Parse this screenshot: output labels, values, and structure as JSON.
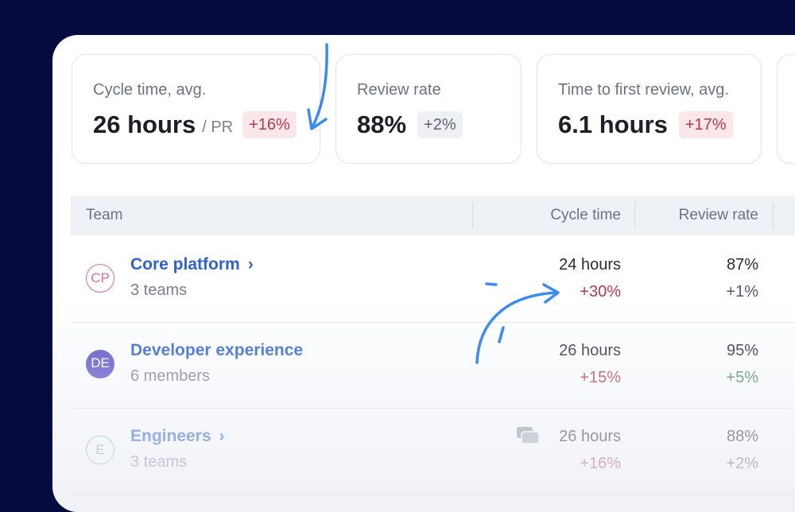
{
  "metrics": [
    {
      "label": "Cycle time, avg.",
      "value": "26 hours",
      "unit": "/ PR",
      "delta": "+16%",
      "delta_tone": "red"
    },
    {
      "label": "Review rate",
      "value": "88%",
      "unit": "",
      "delta": "+2%",
      "delta_tone": "gray"
    },
    {
      "label": "Time to first review, avg.",
      "value": "6.1 hours",
      "unit": "",
      "delta": "+17%",
      "delta_tone": "red"
    }
  ],
  "table": {
    "headers": {
      "team": "Team",
      "cycle_time": "Cycle time",
      "review_rate": "Review rate"
    },
    "rows": [
      {
        "initials": "CP",
        "name": "Core platform",
        "sub": "3 teams",
        "cycle_time": "24 hours",
        "cycle_delta": "+30%",
        "review_rate": "87%",
        "review_delta": "+1%",
        "avatar_color": "#d36aa8",
        "avatar_style": "outline"
      },
      {
        "initials": "DE",
        "name": "Developer experience",
        "sub": "6 members",
        "cycle_time": "26 hours",
        "cycle_delta": "+15%",
        "review_rate": "95%",
        "review_delta": "+5%",
        "avatar_color": "#5b4fc4",
        "avatar_style": "filled"
      },
      {
        "initials": "E",
        "name": "Engineers",
        "sub": "3 teams",
        "cycle_time": "26 hours",
        "cycle_delta": "+16%",
        "review_rate": "88%",
        "review_delta": "+2%",
        "avatar_color": "#5fb0c4",
        "avatar_style": "outline"
      }
    ]
  },
  "colors": {
    "accent": "#2f63c7",
    "annotation": "#3d8bef",
    "negative": "#b23a4d",
    "positive": "#3e8a5c",
    "background": "#060b3f"
  },
  "icons": {
    "chevron": "chevron-right-icon",
    "comments": "comments-icon"
  }
}
